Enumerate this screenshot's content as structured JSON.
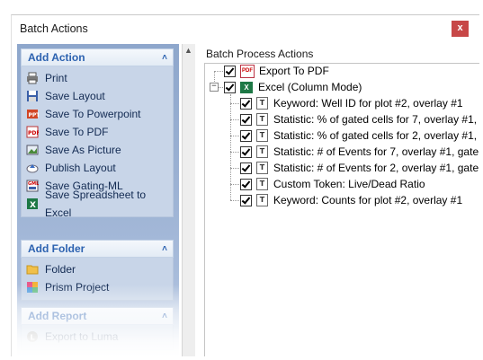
{
  "window": {
    "title": "Batch Actions",
    "close_glyph": "x"
  },
  "left": {
    "groups": [
      {
        "header": "Add Action",
        "items": [
          {
            "label": "Print",
            "icon": "print-icon"
          },
          {
            "label": "Save Layout",
            "icon": "save-layout-icon"
          },
          {
            "label": "Save To Powerpoint",
            "icon": "powerpoint-icon"
          },
          {
            "label": "Save To PDF",
            "icon": "pdf-icon"
          },
          {
            "label": "Save As Picture",
            "icon": "picture-icon"
          },
          {
            "label": "Publish Layout",
            "icon": "publish-cloud-icon"
          },
          {
            "label": "Save Gating-ML",
            "icon": "gating-ml-icon"
          },
          {
            "label": "Save Spreadsheet to Excel",
            "icon": "excel-icon"
          }
        ]
      },
      {
        "header": "Add Folder",
        "items": [
          {
            "label": "Folder",
            "icon": "folder-icon"
          },
          {
            "label": "Prism Project",
            "icon": "prism-icon"
          }
        ]
      },
      {
        "header": "Add Report",
        "items": [
          {
            "label": "Export to Luma",
            "icon": "luma-icon"
          }
        ]
      }
    ]
  },
  "right": {
    "header": "Batch Process Actions",
    "tree": {
      "pdf": {
        "label": "Export To PDF",
        "icon_text": "PDF"
      },
      "excel": {
        "label": "Excel (Column Mode)",
        "icon_text": "X",
        "children": [
          "Keyword: Well ID for plot #2, overlay #1",
          "Statistic: % of gated cells for 7, overlay #1,",
          "Statistic: % of gated cells for 2, overlay #1,",
          "Statistic: # of Events for 7, overlay #1, gate",
          "Statistic: # of Events for 2, overlay #1, gate",
          "Custom Token: Live/Dead Ratio",
          "Keyword: Counts for plot #2, overlay #1"
        ],
        "child_icon_text": "T"
      }
    }
  },
  "colors": {
    "accent": "#2c62b0",
    "close": "#c74747",
    "pane": "#9ab0d2"
  }
}
